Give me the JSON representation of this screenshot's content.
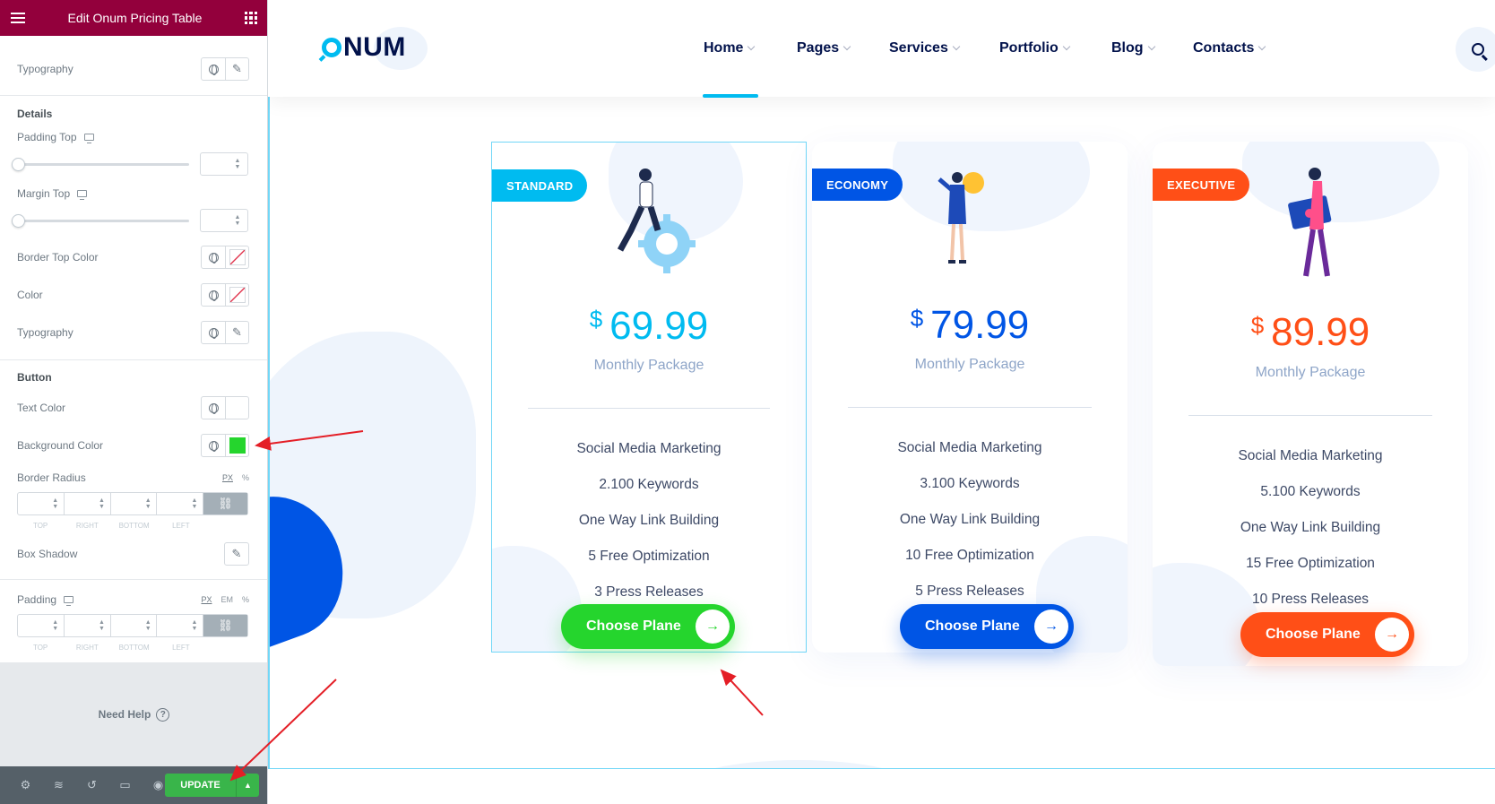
{
  "editor": {
    "title": "Edit Onum Pricing Table",
    "rows": {
      "typography_1": "Typography",
      "details_heading": "Details",
      "padding_top": "Padding Top",
      "margin_top": "Margin Top",
      "border_top_color": "Border Top Color",
      "color": "Color",
      "typography_2": "Typography",
      "button_heading": "Button",
      "text_color": "Text Color",
      "background_color": "Background Color",
      "border_radius": "Border Radius",
      "box_shadow": "Box Shadow",
      "padding": "Padding"
    },
    "units_px": "PX",
    "units_em": "EM",
    "units_pct": "%",
    "dim_labels": [
      "TOP",
      "RIGHT",
      "BOTTOM",
      "LEFT"
    ],
    "background_color_value": "#25d52d",
    "need_help": "Need Help",
    "update_label": "UPDATE"
  },
  "site": {
    "logo": "NUM",
    "nav": [
      {
        "label": "Home"
      },
      {
        "label": "Pages"
      },
      {
        "label": "Services"
      },
      {
        "label": "Portfolio"
      },
      {
        "label": "Blog"
      },
      {
        "label": "Contacts"
      }
    ]
  },
  "pricing": [
    {
      "tag": "STANDARD",
      "currency": "$",
      "price": "69.99",
      "package": "Monthly Package",
      "features": [
        "Social Media Marketing",
        "2.100 Keywords",
        "One Way Link Building",
        "5 Free Optimization",
        "3 Press Releases"
      ],
      "button": "Choose Plane",
      "color": "#00bbf0",
      "button_color": "#25d52d"
    },
    {
      "tag": "ECONOMY",
      "currency": "$",
      "price": "79.99",
      "package": "Monthly Package",
      "features": [
        "Social Media Marketing",
        "3.100 Keywords",
        "One Way Link Building",
        "10 Free Optimization",
        "5 Press Releases"
      ],
      "button": "Choose Plane",
      "color": "#0055e5",
      "button_color": "#0055e5"
    },
    {
      "tag": "EXECUTIVE",
      "currency": "$",
      "price": "89.99",
      "package": "Monthly Package",
      "features": [
        "Social Media Marketing",
        "5.100 Keywords",
        "One Way Link Building",
        "15 Free Optimization",
        "10 Press Releases"
      ],
      "button": "Choose Plane",
      "color": "#ff4f17",
      "button_color": "#ff4f17"
    }
  ]
}
